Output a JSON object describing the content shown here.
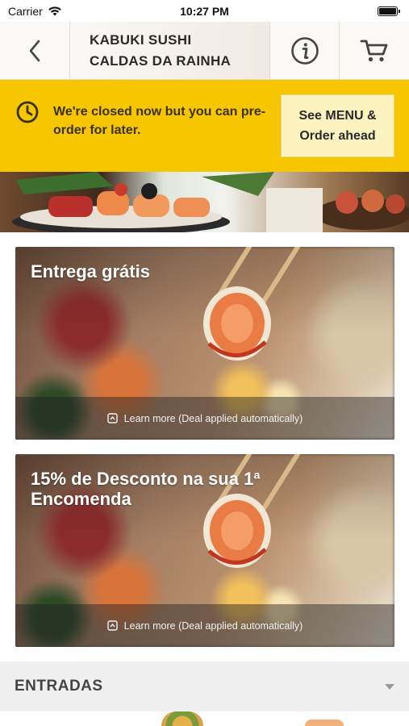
{
  "status_bar": {
    "carrier": "Carrier",
    "time": "10:27 PM"
  },
  "header": {
    "title_line1": "KABUKI SUSHI",
    "title_line2": "CALDAS DA RAINHA",
    "icons": {
      "back": "chevron-left-icon",
      "info": "info-icon",
      "cart": "cart-icon"
    }
  },
  "banner": {
    "message": "We're closed now but you can pre-order for later.",
    "cta": "See MENU & Order ahead",
    "color": "#f6c600"
  },
  "deals": [
    {
      "title": "Entrega grátis",
      "footer": "Learn more (Deal applied automatically)"
    },
    {
      "title": "15% de Desconto na sua 1ª Encomenda",
      "footer": "Learn more (Deal applied automatically)"
    }
  ],
  "category": {
    "label": "ENTRADAS"
  }
}
